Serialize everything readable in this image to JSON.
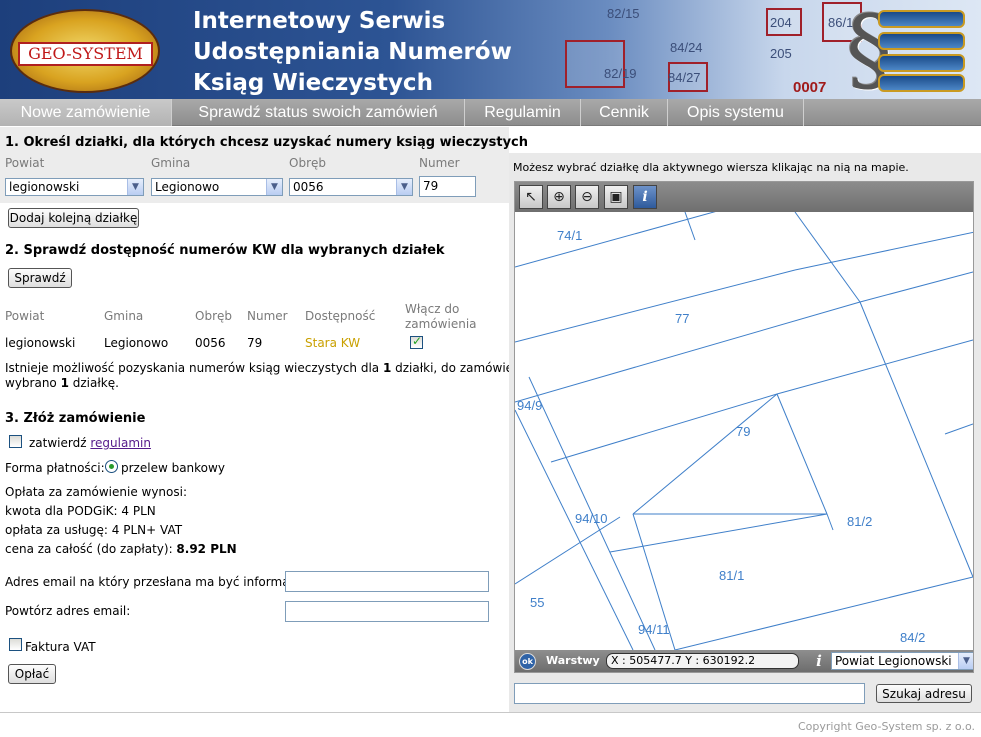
{
  "header": {
    "logo_text": "GEO-SYSTEM",
    "title_lines": [
      "Internetowy Serwis",
      "Udostępniania Numerów",
      "Ksiąg Wieczystych"
    ],
    "bg_map_labels": [
      "82/15",
      "84/24",
      "84/27",
      "204",
      "205",
      "86/1",
      "82/19"
    ],
    "bg_code": "0007",
    "paragraph_symbol": "§"
  },
  "nav": {
    "tabs": [
      {
        "label": "Nowe zamówienie",
        "active": true
      },
      {
        "label": "Sprawdź status swoich zamówień",
        "active": false
      },
      {
        "label": "Regulamin",
        "active": false
      },
      {
        "label": "Cennik",
        "active": false
      },
      {
        "label": "Opis systemu",
        "active": false
      }
    ]
  },
  "step1": {
    "heading": "1. Określ działki, dla których chcesz uzyskać numery ksiąg wieczystych",
    "labels": {
      "powiat": "Powiat",
      "gmina": "Gmina",
      "obreb": "Obręb",
      "numer": "Numer"
    },
    "values": {
      "powiat": "legionowski",
      "gmina": "Legionowo",
      "obreb": "0056",
      "numer": "79"
    },
    "add_button": "Dodaj kolejną działkę"
  },
  "step2": {
    "heading": "2. Sprawdź dostępność numerów KW dla wybranych działek",
    "check_button": "Sprawdź",
    "columns": [
      "Powiat",
      "Gmina",
      "Obręb",
      "Numer",
      "Dostępność",
      "Włącz do",
      "zamówienia"
    ],
    "rows": [
      {
        "powiat": "legionowski",
        "gmina": "Legionowo",
        "obreb": "0056",
        "numer": "79",
        "dostepnosc": "Stara KW",
        "include": true
      }
    ],
    "info_part1": "Istnieje możliwość pozyskania numerów ksiąg wieczystych dla ",
    "info_count1": "1",
    "info_part2": " działki, do zamówienia",
    "info_part3": "wybrano ",
    "info_count2": "1",
    "info_part4": " działkę."
  },
  "step3": {
    "heading": "3. Złóż zamówienie",
    "confirm_label": "zatwierdź",
    "regulamin_link": "regulamin",
    "payment_label": "Forma płatności:",
    "payment_option": "przelew bankowy",
    "fee_header": "Opłata za zamówienie wynosi:",
    "fee_podgik": "kwota dla PODGiK: 4 PLN",
    "fee_service": "opłata za usługę: 4 PLN+ VAT",
    "total_label": "cena za całość (do zapłaty): ",
    "total_value": "8.92 PLN",
    "email_label": "Adres email na który przesłana ma być informacja:",
    "email_repeat_label": "Powtórz adres email:",
    "email_value": "",
    "email_repeat_value": "",
    "invoice_label": "Faktura VAT",
    "pay_button": "Opłać"
  },
  "map": {
    "hint": "Możesz wybrać działkę dla aktywnego wiersza klikając na nią na mapie.",
    "tools": [
      "select-arrow-icon",
      "zoom-in-icon",
      "zoom-out-icon",
      "full-extent-icon",
      "info-icon"
    ],
    "parcel_labels": [
      {
        "text": "74/1"
      },
      {
        "text": "77"
      },
      {
        "text": "94/9"
      },
      {
        "text": "79"
      },
      {
        "text": "94/10"
      },
      {
        "text": "81/2"
      },
      {
        "text": "81/1"
      },
      {
        "text": "55"
      },
      {
        "text": "94/11"
      },
      {
        "text": "84/2"
      }
    ],
    "status_ok": "ok",
    "layers_label": "Warstwy",
    "coords": "X : 505477.7  Y : 630192.2",
    "powiat_select": "Powiat Legionowski",
    "search_placeholder": "",
    "search_button": "Szukaj adresu",
    "line_color": "#3f7fc9"
  },
  "footer": {
    "copyright": "Copyright Geo-System sp. z o.o."
  }
}
